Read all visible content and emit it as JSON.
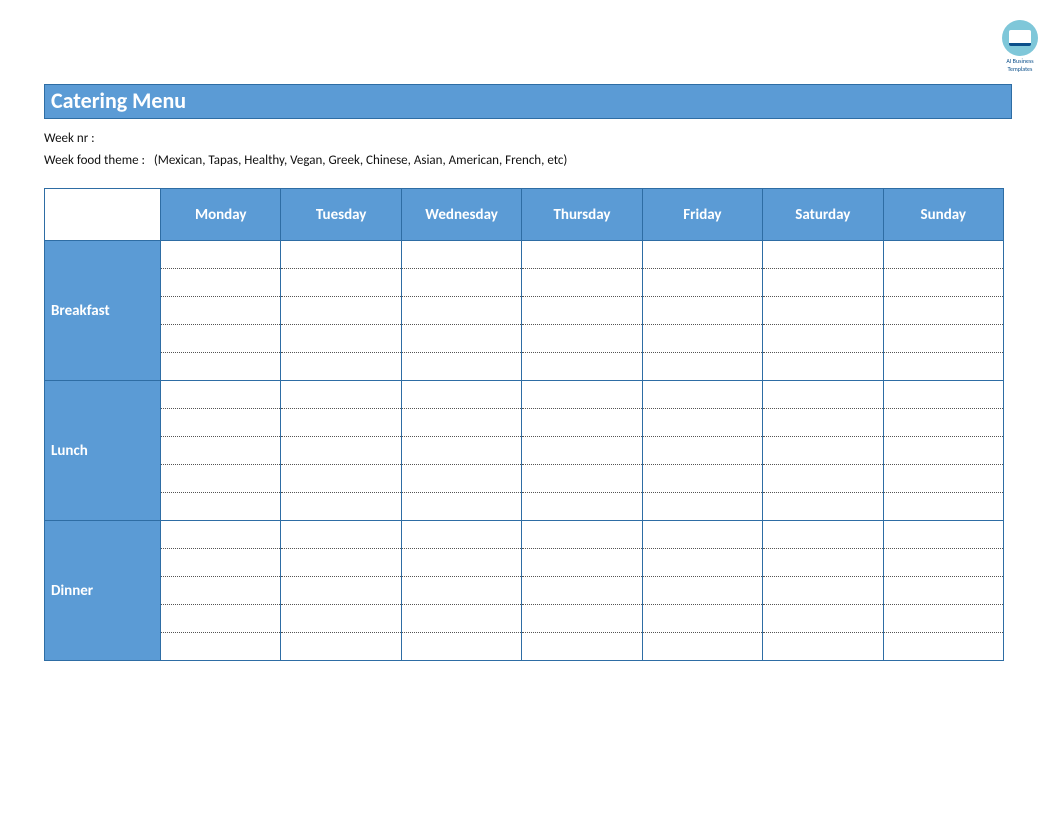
{
  "watermark": {
    "line1": "AI Business",
    "line2": "Templates"
  },
  "title": "Catering Menu",
  "meta": {
    "week_nr_label": "Week nr :",
    "week_nr_value": "",
    "theme_label": "Week food theme :",
    "theme_value": "(Mexican, Tapas, Healthy, Vegan, Greek, Chinese, Asian, American, French, etc)"
  },
  "days": [
    "Monday",
    "Tuesday",
    "Wednesday",
    "Thursday",
    "Friday",
    "Saturday",
    "Sunday"
  ],
  "meals": [
    "Breakfast",
    "Lunch",
    "Dinner"
  ],
  "grid": {
    "Breakfast": {
      "Monday": "",
      "Tuesday": "",
      "Wednesday": "",
      "Thursday": "",
      "Friday": "",
      "Saturday": "",
      "Sunday": ""
    },
    "Lunch": {
      "Monday": "",
      "Tuesday": "",
      "Wednesday": "",
      "Thursday": "",
      "Friday": "",
      "Saturday": "",
      "Sunday": ""
    },
    "Dinner": {
      "Monday": "",
      "Tuesday": "",
      "Wednesday": "",
      "Thursday": "",
      "Friday": "",
      "Saturday": "",
      "Sunday": ""
    }
  },
  "lines_per_cell": 5
}
